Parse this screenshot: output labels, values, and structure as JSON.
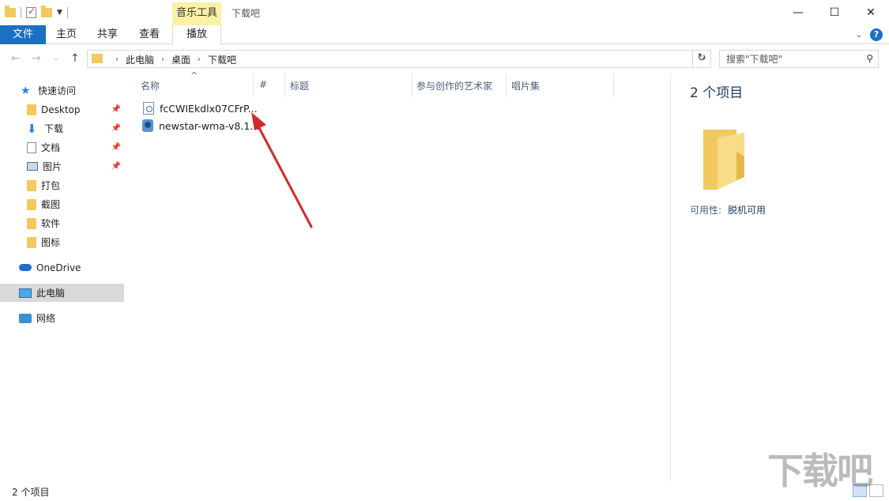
{
  "window": {
    "title": "下载吧",
    "contextual_tab": "音乐工具"
  },
  "ribbon": {
    "tabs": [
      "文件",
      "主页",
      "共享",
      "查看",
      "播放"
    ]
  },
  "address": {
    "crumbs": [
      "此电脑",
      "桌面",
      "下载吧"
    ],
    "search_placeholder": "搜索\"下载吧\""
  },
  "sidebar": {
    "items": [
      {
        "label": "快速访问",
        "icon": "star-icon",
        "pinned": false
      },
      {
        "label": "Desktop",
        "icon": "folder-icon",
        "pinned": true
      },
      {
        "label": "下载",
        "icon": "download-icon",
        "pinned": true
      },
      {
        "label": "文档",
        "icon": "document-icon",
        "pinned": true
      },
      {
        "label": "图片",
        "icon": "pictures-icon",
        "pinned": true
      },
      {
        "label": "打包",
        "icon": "folder-icon",
        "pinned": false
      },
      {
        "label": "截图",
        "icon": "folder-icon",
        "pinned": false
      },
      {
        "label": "软件",
        "icon": "folder-icon",
        "pinned": false
      },
      {
        "label": "图标",
        "icon": "folder-icon",
        "pinned": false
      },
      {
        "label": "OneDrive",
        "icon": "cloud-icon",
        "pinned": false
      },
      {
        "label": "此电脑",
        "icon": "computer-icon",
        "pinned": false,
        "selected": true
      },
      {
        "label": "网络",
        "icon": "network-icon",
        "pinned": false
      }
    ]
  },
  "columns": [
    "名称",
    "#",
    "标题",
    "参与创作的艺术家",
    "唱片集"
  ],
  "files": [
    {
      "name": "fcCWIEkdlx07CFrP...",
      "icon": "audio-file-icon"
    },
    {
      "name": "newstar-wma-v8.1...",
      "icon": "installer-icon"
    }
  ],
  "details": {
    "count": "2 个项目",
    "availability_label": "可用性:",
    "availability_value": "脱机可用"
  },
  "status": {
    "count": "2 个项目"
  },
  "watermark": "下载吧",
  "colors": {
    "accent": "#1a70c6",
    "contextual_tab_bg": "#faf0a6",
    "arrow": "#d42a2a"
  }
}
